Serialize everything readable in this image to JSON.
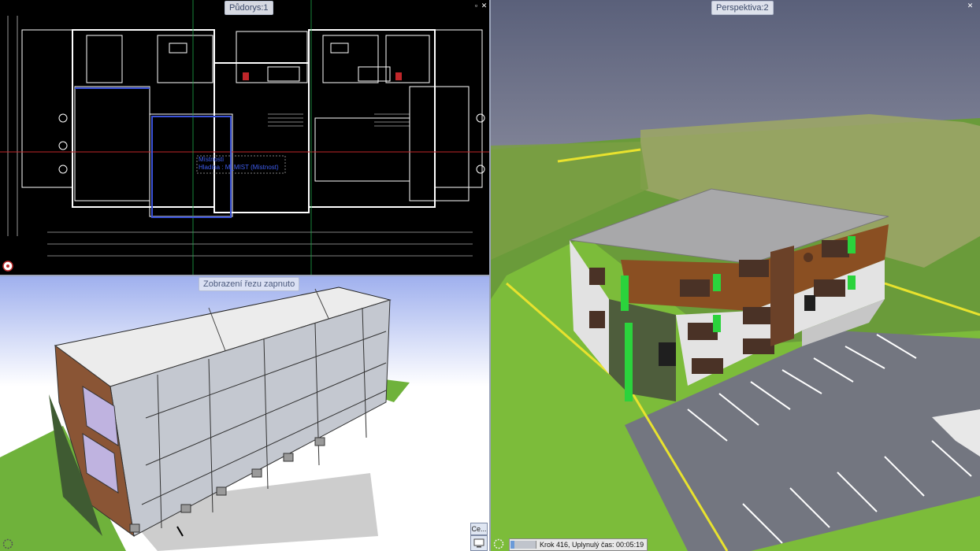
{
  "plan_view": {
    "title": "Půdorys:1",
    "tooltip_line1": "Místnosti",
    "tooltip_line2": "Hladina : M_MIST (Místnost)"
  },
  "section_view": {
    "title": "Zobrazení řezu zapnuto"
  },
  "perspective_view": {
    "title": "Perspektiva:2"
  },
  "status_bar": {
    "progress_value": 0.15,
    "text": "Krok 416, Uplynulý čas: 00:05:19"
  },
  "side_panel": {
    "button_label": "Ce..."
  },
  "icons": {
    "close": "close-icon",
    "restore": "restore-icon",
    "navigation": "navigation-wheel-icon"
  },
  "colors": {
    "plan_background": "#000000",
    "section_background": "#ffffff",
    "sky": "#5a607a",
    "grass": "#78b53a",
    "parking": "#7a7d86",
    "facade_brown": "#8a4f22",
    "facade_white": "#e2e2e2",
    "accent_green": "#2bd33c"
  }
}
